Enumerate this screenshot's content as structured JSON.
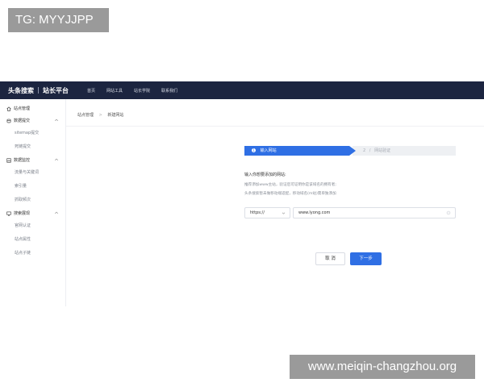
{
  "watermarks": {
    "top": "TG: MYYJJPP",
    "bottom": "www.meiqin-changzhou.org"
  },
  "header": {
    "brand_name": "头条搜索",
    "brand_sub": "站长平台",
    "nav": [
      {
        "label": "首页"
      },
      {
        "label": "网站工具"
      },
      {
        "label": "站长学院"
      },
      {
        "label": "联系我们"
      }
    ]
  },
  "sidebar": {
    "groups": [
      {
        "label": "站点管理",
        "icon": "home-icon",
        "items": []
      },
      {
        "label": "数据提交",
        "icon": "database-icon",
        "items": [
          {
            "label": "sitemap提交"
          },
          {
            "label": "死链提交"
          }
        ]
      },
      {
        "label": "数据监控",
        "icon": "chart-icon",
        "items": [
          {
            "label": "流量与关键词"
          },
          {
            "label": "索引量"
          },
          {
            "label": "抓取频次"
          }
        ]
      },
      {
        "label": "搜索展现",
        "icon": "monitor-icon",
        "items": [
          {
            "label": "官网认证"
          },
          {
            "label": "站点属性"
          },
          {
            "label": "站点子链"
          }
        ]
      }
    ]
  },
  "breadcrumb": {
    "items": [
      "站点管理",
      "新建网站"
    ],
    "separator": ">"
  },
  "steps": [
    {
      "num": "1",
      "label": "输入网站",
      "active": true
    },
    {
      "num": "2",
      "label": "网站验证",
      "active": false
    }
  ],
  "form": {
    "title": "输入你想要添加的网站:",
    "tips": [
      "推荐添加www主站，验证后可证明你是该域名的拥有者;",
      "头条搜索暂未做移动端适配，移动域名(m站)需单独添加"
    ],
    "protocol": "https://",
    "site_value": "www.lyong.com",
    "cancel_label": "取 消",
    "next_label": "下一步"
  },
  "colors": {
    "topbar": "#1c2540",
    "accent": "#2f6fe4"
  }
}
